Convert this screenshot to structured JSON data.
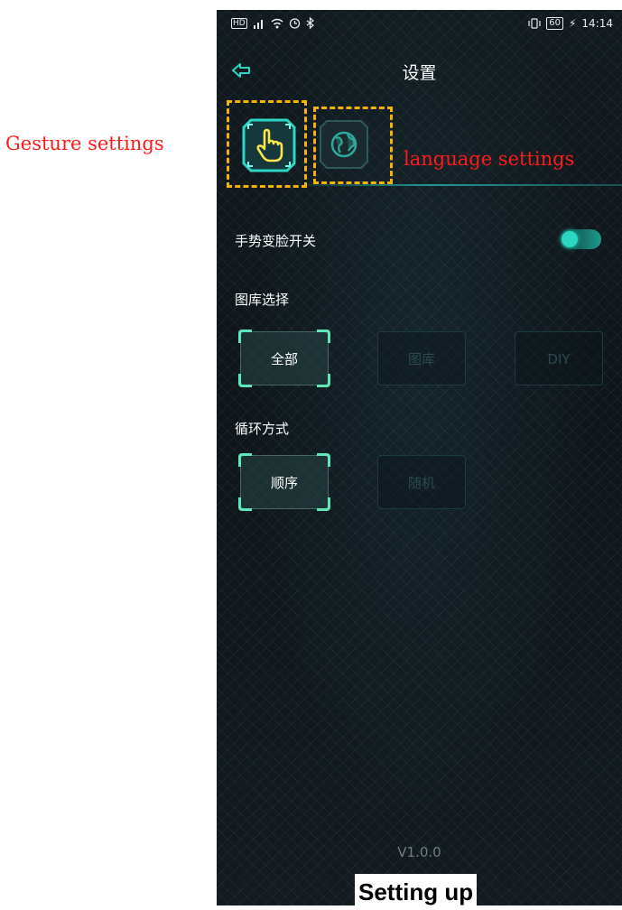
{
  "annotations": {
    "gesture_label": "Gesture settings",
    "language_label": "language settings",
    "caption": "Setting up"
  },
  "status_bar": {
    "left_icons": [
      "hd-icon",
      "signal-icon",
      "wifi-icon",
      "alarm-icon",
      "bluetooth-icon"
    ],
    "battery": "60",
    "time": "14:14"
  },
  "app_bar": {
    "title": "设置",
    "back_icon": "back-arrow-icon"
  },
  "tabs": [
    {
      "name": "gesture",
      "icon": "hand-pointer-icon",
      "active": true
    },
    {
      "name": "language",
      "icon": "globe-icon",
      "active": false
    }
  ],
  "settings": {
    "gesture_switch_label": "手势变脸开关",
    "gesture_switch_on": true,
    "gallery_label": "图库选择",
    "gallery_options": [
      {
        "label": "全部",
        "selected": true
      },
      {
        "label": "图库",
        "selected": false
      },
      {
        "label": "DIY",
        "selected": false
      }
    ],
    "loop_label": "循环方式",
    "loop_options": [
      {
        "label": "顺序",
        "selected": true
      },
      {
        "label": "随机",
        "selected": false
      }
    ]
  },
  "version": "V1.0.0",
  "colors": {
    "accent": "#2bd6c3",
    "icon_yellow": "#ffe44a",
    "annotation_red": "#ff1a1a",
    "dash_yellow": "#f4b400"
  }
}
